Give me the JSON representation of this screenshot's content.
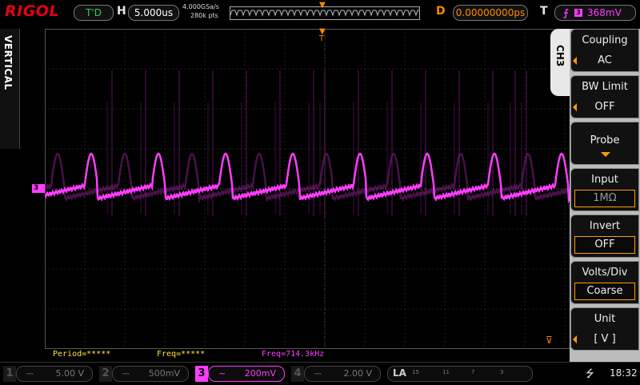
{
  "brand": "RIGOL",
  "header": {
    "trigger_status": "T'D",
    "h_label": "H",
    "timebase": "5.000us",
    "sample_rate": "4.000GSa/s",
    "memory_depth": "280k pts",
    "d_label": "D",
    "delay": "0.00000000ps",
    "t_label": "T",
    "trigger_channel": "3",
    "trigger_level": "368mV"
  },
  "left_tab": "VERTICAL",
  "channel_marker": "3",
  "measurements": [
    {
      "text": "Period=*****",
      "color": "#ffe04d"
    },
    {
      "text": "Freq=*****",
      "color": "#ffe04d"
    },
    {
      "text": "Freq=714.3kHz",
      "color": "#ff3dff"
    }
  ],
  "menu": {
    "channel_tab": "CH3",
    "items": [
      {
        "label": "Coupling",
        "value": "AC"
      },
      {
        "label": "BW Limit",
        "value": "OFF"
      },
      {
        "label": "Probe",
        "value": ""
      },
      {
        "label": "Input",
        "value": "1MΩ"
      },
      {
        "label": "Invert",
        "value": "OFF"
      },
      {
        "label": "Volts/Div",
        "value": "Coarse"
      },
      {
        "label": "Unit",
        "value": "[  V  ]"
      }
    ]
  },
  "channels": [
    {
      "num": "1",
      "coupling": "⎓",
      "scale": "5.00 V",
      "active": false
    },
    {
      "num": "2",
      "coupling": "⎓",
      "scale": "500mV",
      "active": false
    },
    {
      "num": "3",
      "coupling": "~",
      "scale": "200mV",
      "active": true
    },
    {
      "num": "4",
      "coupling": "⎓",
      "scale": "2.00 V",
      "active": false
    }
  ],
  "la": {
    "label": "LA",
    "groups": [
      "15",
      "11",
      "7",
      "3"
    ]
  },
  "clock": "18:32",
  "colors": {
    "ch3": "#ff3dff",
    "trigger": "#ff8a00",
    "brand": "#e60012",
    "measure_yellow": "#ffe04d"
  },
  "waveform": {
    "frequency_khz": 714.3,
    "period_us": 1.4,
    "timebase_us_per_div": 5,
    "volts_per_div_mv": 200,
    "trigger_level_mv": 368,
    "shape": "sawtooth-ramp-with-overshoot-pulses",
    "pulse_times_us": [
      -26.6,
      -22.4,
      -18.2,
      -14.0,
      -9.8,
      -5.6,
      -1.4,
      0,
      4.2,
      8.4,
      12.6,
      16.8,
      21.0,
      23.8,
      25.2
    ]
  }
}
